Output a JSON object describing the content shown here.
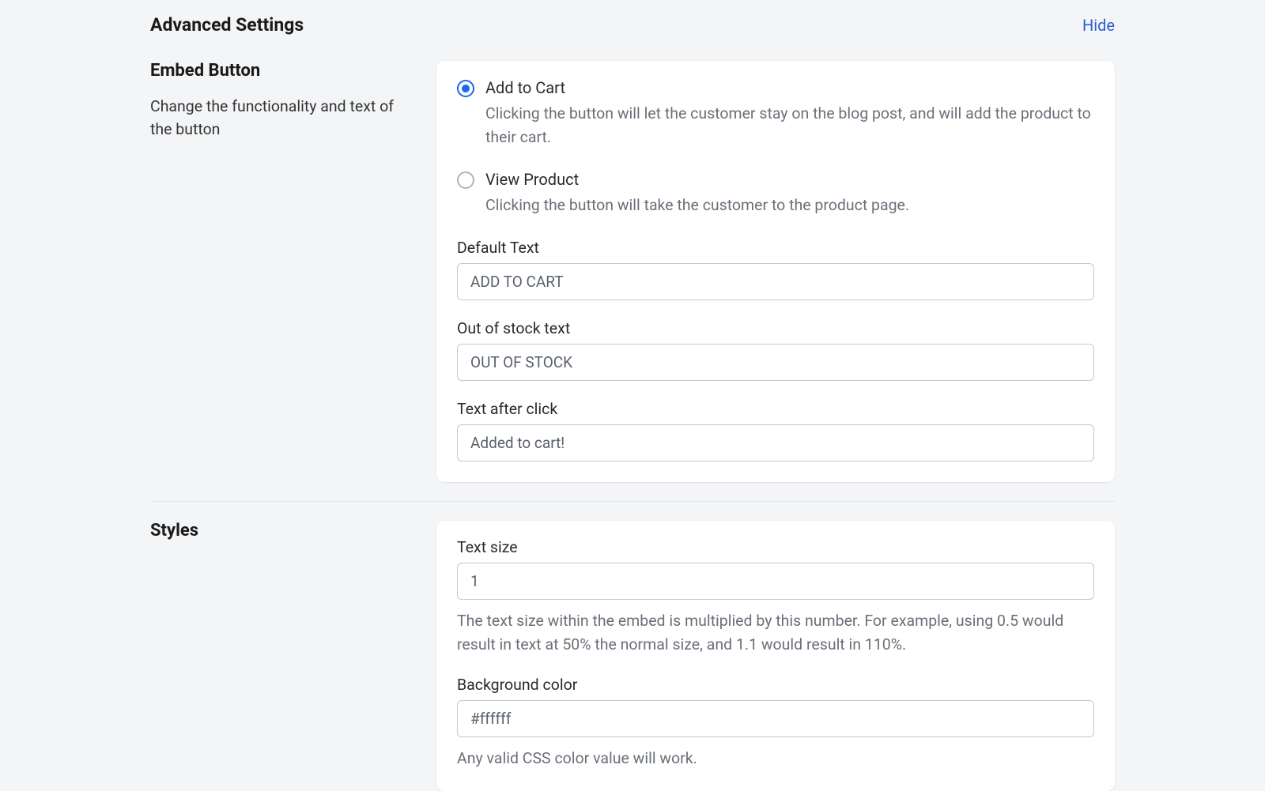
{
  "header": {
    "title": "Advanced Settings",
    "hide_label": "Hide"
  },
  "embed_button": {
    "section_title": "Embed Button",
    "section_desc": "Change the functionality and text of the button",
    "options": [
      {
        "label": "Add to Cart",
        "description": "Clicking the button will let the customer stay on the blog post, and will add the product to their cart.",
        "selected": true
      },
      {
        "label": "View Product",
        "description": "Clicking the button will take the customer to the product page.",
        "selected": false
      }
    ],
    "default_text": {
      "label": "Default Text",
      "value": "ADD TO CART"
    },
    "out_of_stock_text": {
      "label": "Out of stock text",
      "value": "OUT OF STOCK"
    },
    "text_after_click": {
      "label": "Text after click",
      "value": "Added to cart!"
    }
  },
  "styles": {
    "section_title": "Styles",
    "text_size": {
      "label": "Text size",
      "value": "1",
      "help": "The text size within the embed is multiplied by this number. For example, using 0.5 would result in text at 50% the normal size, and 1.1 would result in 110%."
    },
    "background_color": {
      "label": "Background color",
      "value": "#ffffff",
      "help": "Any valid CSS color value will work."
    }
  }
}
